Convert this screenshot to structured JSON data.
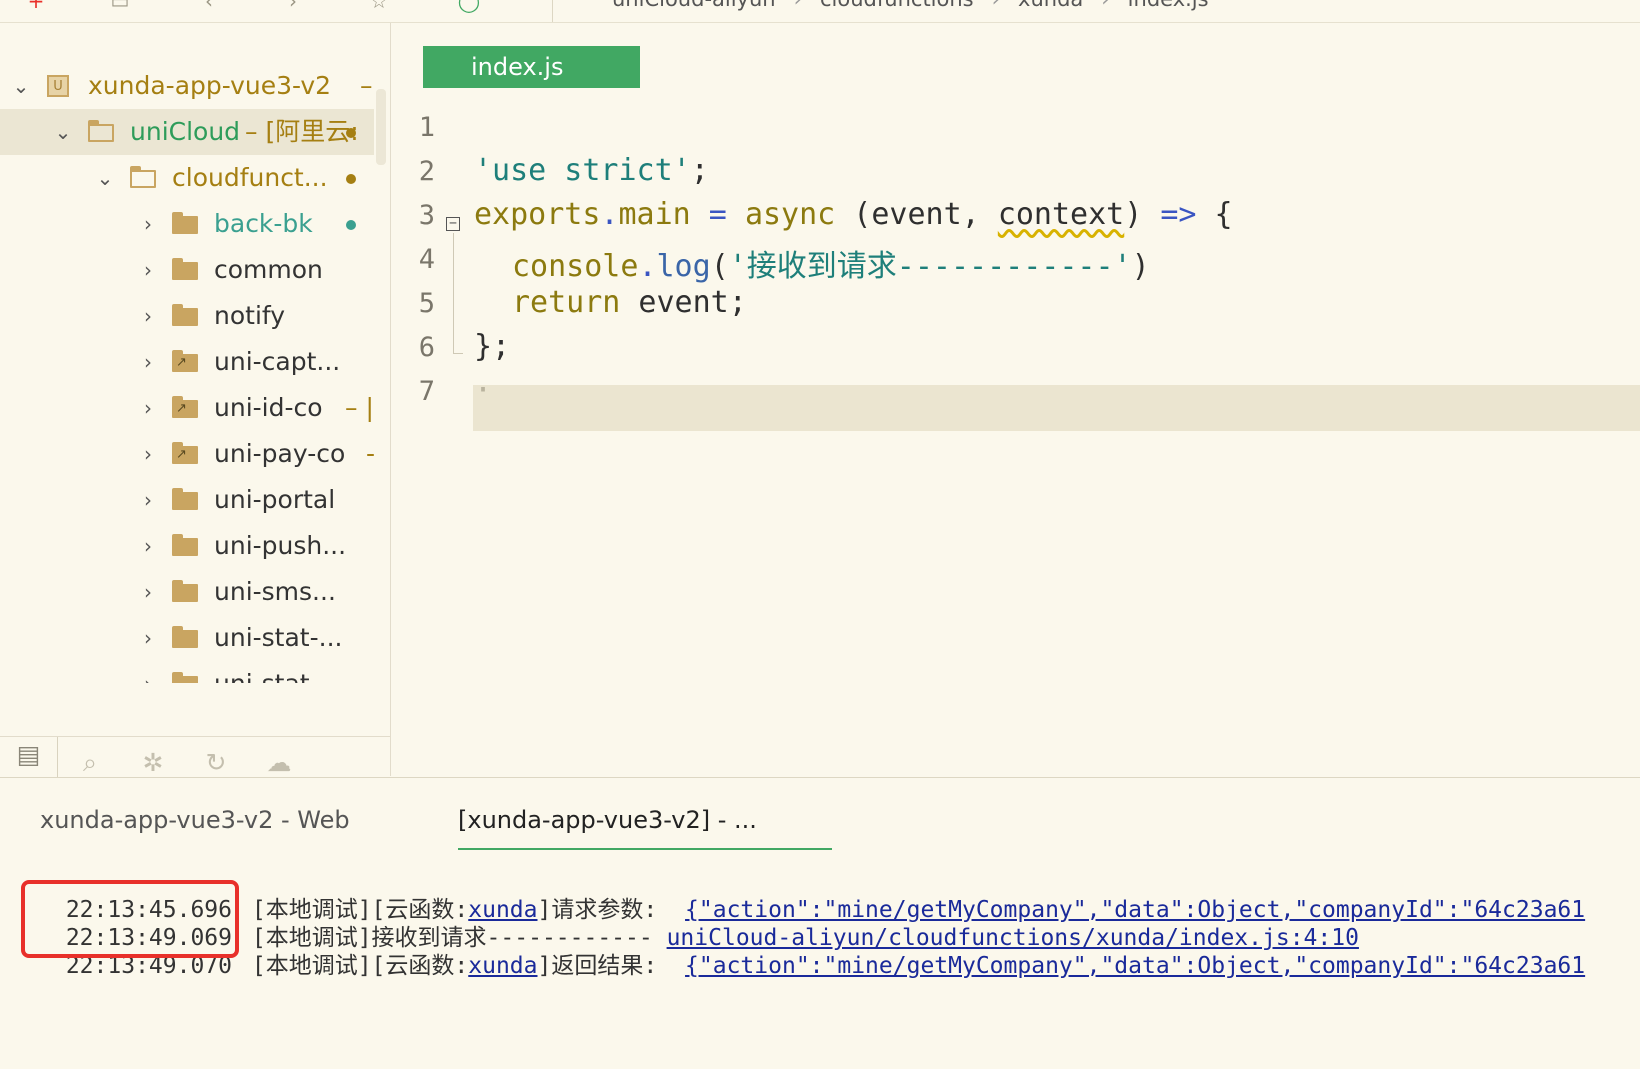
{
  "breadcrumb": {
    "items": [
      "uniCloud-aliyun",
      "cloudfunctions",
      "xunda",
      "index.js"
    ]
  },
  "sidebar": {
    "items": [
      {
        "label": "xunda-app-vue3-v2",
        "suffix": "–"
      },
      {
        "label": "uniCloud",
        "suffix": "– [阿里云:"
      },
      {
        "label": "cloudfunct..."
      },
      {
        "label": "back-bk"
      },
      {
        "label": "common"
      },
      {
        "label": "notify"
      },
      {
        "label": "uni-capt..."
      },
      {
        "label": "uni-id-co",
        "suffix": "– |"
      },
      {
        "label": "uni-pay-co",
        "suffix": "-"
      },
      {
        "label": "uni-portal"
      },
      {
        "label": "uni-push..."
      },
      {
        "label": "uni-sms..."
      },
      {
        "label": "uni-stat-..."
      },
      {
        "label": "uni-stat"
      }
    ]
  },
  "editor": {
    "tab_label": "index.js",
    "line_numbers": [
      "1",
      "2",
      "3",
      "4",
      "5",
      "6",
      "7"
    ],
    "code": {
      "l2_str": "'use strict'",
      "l2_end": ";",
      "l3_exports": "exports",
      "l3_dot": ".",
      "l3_main": "main",
      "l3_eq": " = ",
      "l3_async": "async",
      "l3_open": " (event, ",
      "l3_context": "context",
      "l3_close": ") ",
      "l3_arrow": "=>",
      "l3_brace": " {",
      "l4_console": "console",
      "l4_dot": ".",
      "l4_log": "log",
      "l4_paren": "(",
      "l4_str": "'接收到请求------------'",
      "l4_end": ")",
      "l5_return": "return",
      "l5_rest": " event;",
      "l6": "};",
      "l7": "·"
    }
  },
  "console": {
    "tabs": [
      "xunda-app-vue3-v2 - Web",
      "[xunda-app-vue3-v2] - ..."
    ],
    "logs": [
      {
        "time": "22:13:45.696",
        "pre": "[本地调试][云函数:",
        "fn": "xunda",
        "mid": "]请求参数: ",
        "link": "{\"action\":\"mine/getMyCompany\",\"data\":Object,\"companyId\":\"64c23a61"
      },
      {
        "time": "22:13:49.069",
        "pre": "[本地调试]接收到请求------------ ",
        "link": "uniCloud-aliyun/cloudfunctions/xunda/index.js:4:10"
      },
      {
        "time": "22:13:49.070",
        "pre": "[本地调试][云函数:",
        "fn": "xunda",
        "mid": "]返回结果: ",
        "link": "{\"action\":\"mine/getMyCompany\",\"data\":Object,\"companyId\":\"64c23a61"
      }
    ]
  },
  "colors": {
    "accent": "#41a863",
    "folder": "#c9a561",
    "highlight": "#e8302a",
    "background": "#fbf8ec"
  },
  "icons": [
    "add-icon",
    "save-icon",
    "back-icon",
    "forward-icon",
    "star-icon",
    "run-icon",
    "project-icon",
    "folder-icon",
    "explorer-icon",
    "search-icon",
    "debug-icon",
    "sync-icon",
    "cloud-icon"
  ]
}
